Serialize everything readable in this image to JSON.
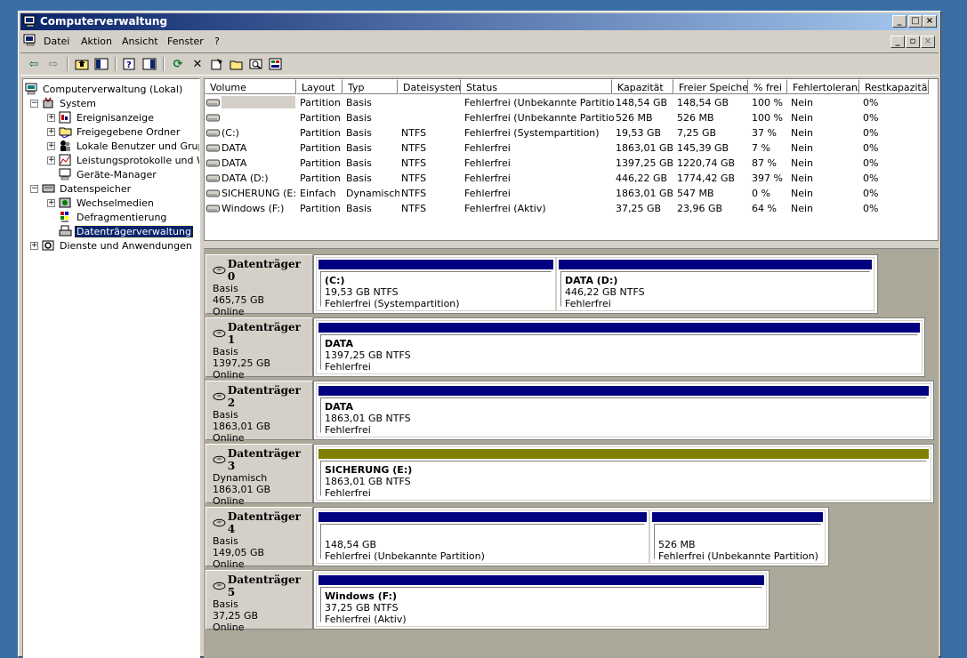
{
  "title": "Computerverwaltung",
  "menu": [
    "Datei",
    "Aktion",
    "Ansicht",
    "Fenster",
    "?"
  ],
  "tree": {
    "root": "Computerverwaltung (Lokal)",
    "system": "System",
    "event": "Ereignisanzeige",
    "shared": "Freigegebene Ordner",
    "users": "Lokale Benutzer und Gruppe",
    "perf": "Leistungsprotokolle und War",
    "device": "Geräte-Manager",
    "storage": "Datenspeicher",
    "removable": "Wechselmedien",
    "defrag": "Defragmentierung",
    "diskmgmt": "Datenträgerverwaltung",
    "services": "Dienste und Anwendungen"
  },
  "columns": [
    "Volume",
    "Layout",
    "Typ",
    "Dateisystem",
    "Status",
    "Kapazität",
    "Freier Speicher",
    "% frei",
    "Fehlertoleranz",
    "Restkapazität"
  ],
  "volumes": [
    [
      "",
      "Partition",
      "Basis",
      "",
      "Fehlerfrei (Unbekannte Partition)",
      "148,54 GB",
      "148,54 GB",
      "100 %",
      "Nein",
      "0%"
    ],
    [
      "",
      "Partition",
      "Basis",
      "",
      "Fehlerfrei (Unbekannte Partition)",
      "526 MB",
      "526 MB",
      "100 %",
      "Nein",
      "0%"
    ],
    [
      "(C:)",
      "Partition",
      "Basis",
      "NTFS",
      "Fehlerfrei (Systempartition)",
      "19,53 GB",
      "7,25 GB",
      "37 %",
      "Nein",
      "0%"
    ],
    [
      "DATA",
      "Partition",
      "Basis",
      "NTFS",
      "Fehlerfrei",
      "1863,01 GB",
      "145,39 GB",
      "7 %",
      "Nein",
      "0%"
    ],
    [
      "DATA",
      "Partition",
      "Basis",
      "NTFS",
      "Fehlerfrei",
      "1397,25 GB",
      "1220,74 GB",
      "87 %",
      "Nein",
      "0%"
    ],
    [
      "DATA (D:)",
      "Partition",
      "Basis",
      "NTFS",
      "Fehlerfrei",
      "446,22 GB",
      "1774,42 GB",
      "397 %",
      "Nein",
      "0%"
    ],
    [
      "SICHERUNG (E:)",
      "Einfach",
      "Dynamisch",
      "NTFS",
      "Fehlerfrei",
      "1863,01 GB",
      "547 MB",
      "0 %",
      "Nein",
      "0%"
    ],
    [
      "Windows (F:)",
      "Partition",
      "Basis",
      "NTFS",
      "Fehlerfrei (Aktiv)",
      "37,25 GB",
      "23,96 GB",
      "64 %",
      "Nein",
      "0%"
    ]
  ],
  "disks": [
    {
      "name": "Datenträger 0",
      "type": "Basis",
      "size": "465,75 GB",
      "status": "Online",
      "parts": [
        {
          "title": "(C:)",
          "size": "19,53 GB NTFS",
          "status": "Fehlerfrei (Systempartition)"
        },
        {
          "title": "DATA  (D:)",
          "size": "446,22 GB NTFS",
          "status": "Fehlerfrei"
        }
      ]
    },
    {
      "name": "Datenträger 1",
      "type": "Basis",
      "size": "1397,25 GB",
      "status": "Online",
      "parts": [
        {
          "title": "DATA",
          "size": "1397,25 GB NTFS",
          "status": "Fehlerfrei"
        }
      ]
    },
    {
      "name": "Datenträger 2",
      "type": "Basis",
      "size": "1863,01 GB",
      "status": "Online",
      "parts": [
        {
          "title": "DATA",
          "size": "1863,01 GB NTFS",
          "status": "Fehlerfrei"
        }
      ]
    },
    {
      "name": "Datenträger 3",
      "type": "Dynamisch",
      "size": "1863,01 GB",
      "status": "Online",
      "parts": [
        {
          "title": "SICHERUNG  (E:)",
          "size": "1863,01 GB NTFS",
          "status": "Fehlerfrei"
        }
      ]
    },
    {
      "name": "Datenträger 4",
      "type": "Basis",
      "size": "149,05 GB",
      "status": "Online",
      "parts": [
        {
          "title": "",
          "size": "148,54 GB",
          "status": "Fehlerfrei (Unbekannte Partition)"
        },
        {
          "title": "",
          "size": "526 MB",
          "status": "Fehlerfrei (Unbekannte Partition)"
        }
      ]
    },
    {
      "name": "Datenträger 5",
      "type": "Basis",
      "size": "37,25 GB",
      "status": "Online",
      "parts": [
        {
          "title": "Windows  (F:)",
          "size": "37,25 GB NTFS",
          "status": "Fehlerfrei (Aktiv)"
        }
      ]
    }
  ],
  "colors": {
    "basic_bar": "#000080",
    "dynamic_bar": "#808000",
    "title_start": "#0a246a",
    "title_end": "#a6caf0"
  }
}
